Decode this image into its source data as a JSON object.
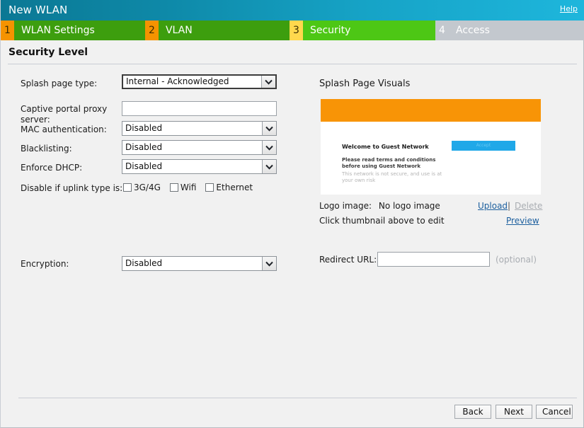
{
  "window": {
    "title": "New WLAN",
    "help_label": "Help"
  },
  "steps": [
    {
      "num": "1",
      "label": "WLAN Settings",
      "state": "done"
    },
    {
      "num": "2",
      "label": "VLAN",
      "state": "done"
    },
    {
      "num": "3",
      "label": "Security",
      "state": "current"
    },
    {
      "num": "4",
      "label": "Access",
      "state": "todo"
    }
  ],
  "section": {
    "title": "Security Level"
  },
  "form": {
    "splash_page_type": {
      "label": "Splash page type:",
      "value": "Internal - Acknowledged"
    },
    "captive_portal_proxy": {
      "label_line1": "Captive portal proxy",
      "label_line2": "server:",
      "value": ""
    },
    "mac_authentication": {
      "label": "MAC authentication:",
      "value": "Disabled"
    },
    "blacklisting": {
      "label": "Blacklisting:",
      "value": "Disabled"
    },
    "enforce_dhcp": {
      "label": "Enforce DHCP:",
      "value": "Disabled"
    },
    "disable_if_uplink": {
      "label": "Disable if uplink type is:",
      "options": [
        {
          "label": "3G/4G",
          "checked": false
        },
        {
          "label": "Wifi",
          "checked": false
        },
        {
          "label": "Ethernet",
          "checked": false
        }
      ]
    },
    "encryption": {
      "label": "Encryption:",
      "value": "Disabled"
    }
  },
  "splash_panel": {
    "title": "Splash Page Visuals",
    "preview": {
      "heading": "Welcome to Guest Network",
      "terms": "Please read terms and conditions before using Guest Network",
      "disclaimer": "This network is not secure, and use is at your own risk",
      "button_label": "Accept"
    },
    "logo_label": "Logo image:",
    "logo_value": "No logo image",
    "upload_label": "Upload",
    "separator": "|",
    "delete_label": "Delete",
    "hint": "Click thumbnail above to edit",
    "preview_label": "Preview",
    "redirect_url": {
      "label": "Redirect URL:",
      "value": "",
      "optional_note": "(optional)"
    }
  },
  "footer": {
    "back_label": "Back",
    "next_label": "Next",
    "cancel_label": "Cancel"
  }
}
